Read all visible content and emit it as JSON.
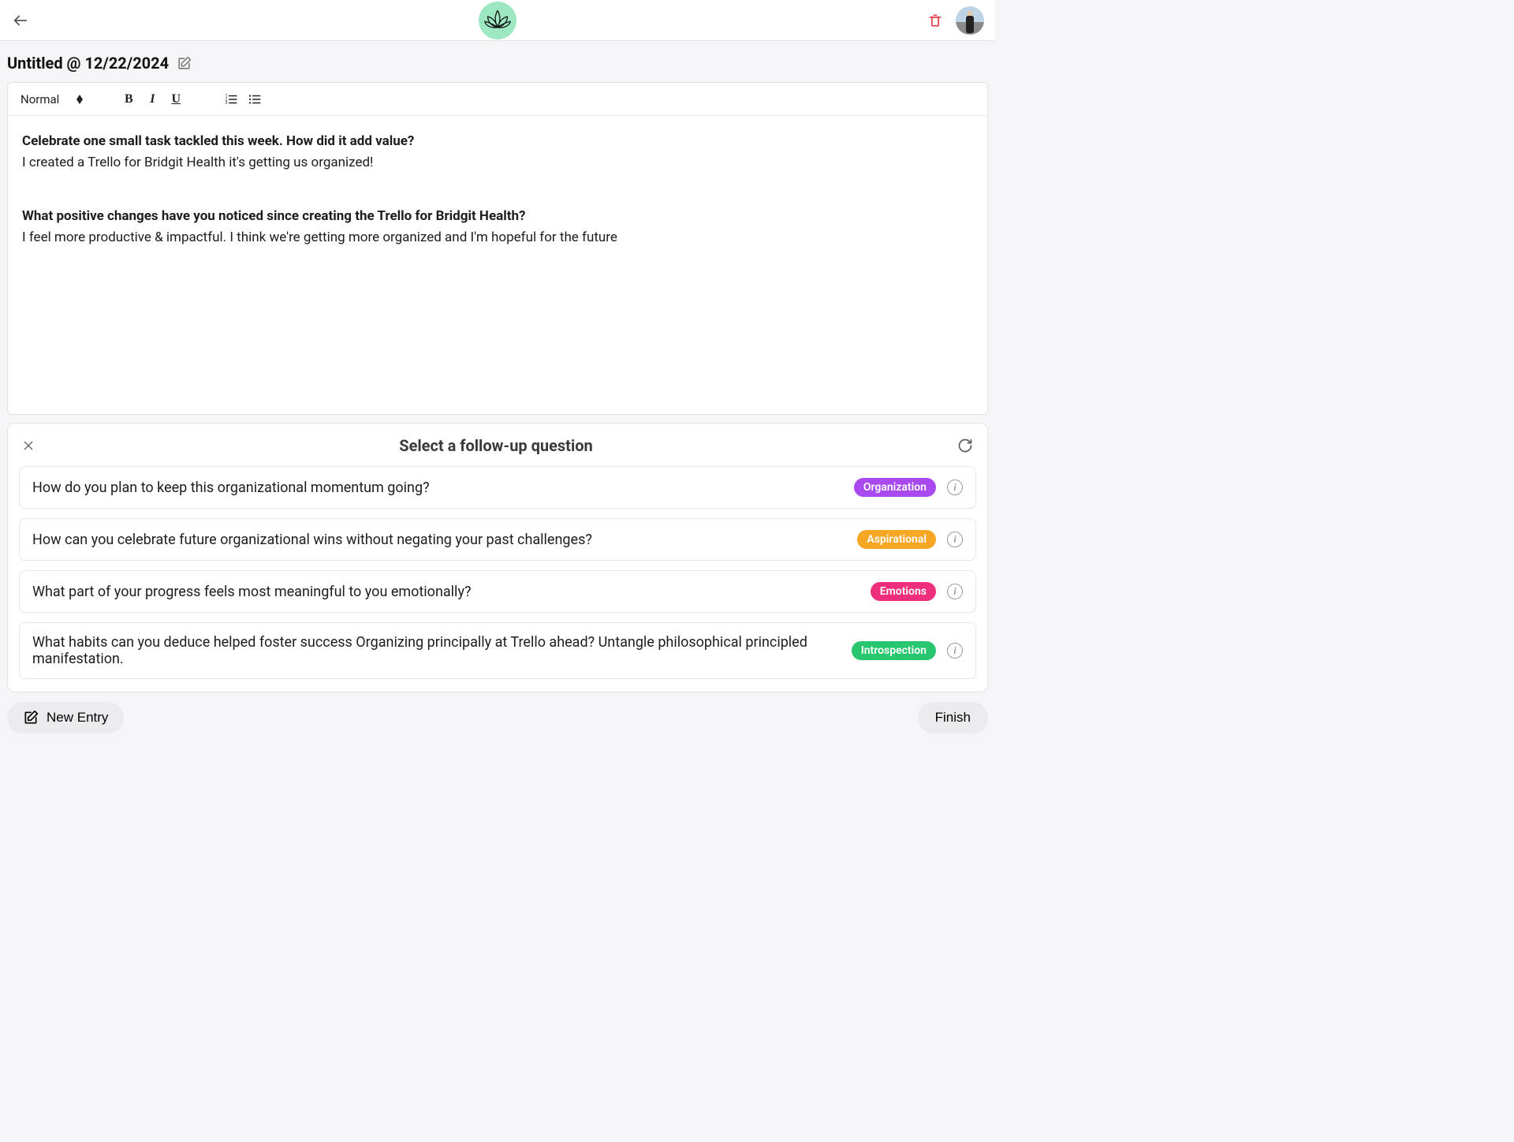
{
  "header": {
    "logo_name": "lotus-logo"
  },
  "page": {
    "title": "Untitled @ 12/22/2024"
  },
  "toolbar": {
    "heading_label": "Normal",
    "bold": "B",
    "italic": "I",
    "underline": "U"
  },
  "journal": {
    "q1": "Celebrate one small task tackled this week. How did it add value?",
    "a1": "I created a Trello for Bridgit Health it's getting us organized!",
    "q2": "What positive changes have you noticed since creating the Trello for Bridgit Health?",
    "a2": "I feel more productive & impactful. I think we're getting more organized and I'm hopeful for the future"
  },
  "followup": {
    "title": "Select a follow-up question",
    "items": [
      {
        "text": "How do you plan to keep this organizational momentum going?",
        "tag": "Organization",
        "tag_class": "organization"
      },
      {
        "text": "How can you celebrate future organizational wins without negating your past challenges?",
        "tag": "Aspirational",
        "tag_class": "aspirational"
      },
      {
        "text": "What part of your progress feels most meaningful to you emotionally?",
        "tag": "Emotions",
        "tag_class": "emotions"
      },
      {
        "text": "What habits can you deduce helped foster success Organizing principally at Trello ahead? Untangle philosophical principled manifestation.",
        "tag": "Introspection",
        "tag_class": "introspection"
      }
    ]
  },
  "footer": {
    "new_entry": "New Entry",
    "finish": "Finish"
  }
}
